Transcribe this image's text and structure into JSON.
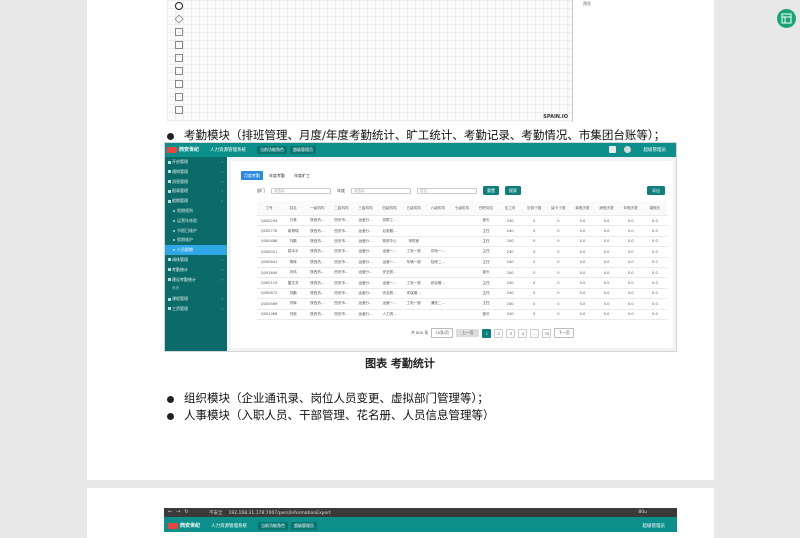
{
  "doc": {
    "fig_top": {
      "brand": "SPAIN.IO",
      "side_hint": "预览",
      "tools": [
        "circle",
        "diamond",
        "rect",
        "rect",
        "rect",
        "rect",
        "rect",
        "rect",
        "rect"
      ]
    },
    "bullets": [
      "考勤模块（排班管理、月度/年度考勤统计、旷工统计、考勤记录、考勤情况、市集团台账等）；",
      "组织模块（企业通讯录、岗位人员变更、虚拟部门管理等）；",
      "人事模块（入职人员、干部管理、花名册、人员信息管理等）"
    ],
    "caption": "图表 考勤统计"
  },
  "app": {
    "logo": "西安世纪",
    "system_name": "人力资源管理系统",
    "crumbs": [
      "当前功能角色",
      "超级管理员"
    ],
    "user": "超级管理员",
    "sidebar": [
      {
        "label": "开启管理",
        "type": "top"
      },
      {
        "label": "通知管理",
        "type": "top"
      },
      {
        "label": "消息管理",
        "type": "top"
      },
      {
        "label": "报表管理",
        "type": "top"
      },
      {
        "label": "假期管理",
        "type": "top"
      },
      {
        "label": "假期规则",
        "type": "sub"
      },
      {
        "label": "运营年休假",
        "type": "sub"
      },
      {
        "label": "节假日维护",
        "type": "sub"
      },
      {
        "label": "假期维护",
        "type": "sub"
      },
      {
        "label": "人员假期",
        "type": "sub",
        "active": true
      },
      {
        "label": "调休管理",
        "type": "top"
      },
      {
        "label": "考勤统计",
        "type": "top"
      },
      {
        "label": "建议考勤统计",
        "type": "top"
      },
      {
        "label": "系统",
        "type": "section"
      },
      {
        "label": "课程管理",
        "type": "top"
      },
      {
        "label": "工资管理",
        "type": "top"
      }
    ],
    "tabs": [
      "月度考勤",
      "年度考勤",
      "年度旷工"
    ],
    "filters": {
      "dept_label": "部门",
      "dept_placeholder": "请选择",
      "year_label": "年度",
      "year_placeholder": "请选择",
      "name_placeholder": "姓名",
      "reset": "重置",
      "search": "搜索",
      "export": "导出"
    },
    "columns": [
      "工号",
      "姓名",
      "一级机构",
      "二级机构",
      "三级机构",
      "四级机构",
      "五级机构",
      "六级机构",
      "七级机构",
      "任职岗位",
      "应工时",
      "迟到个数",
      "缺卡个数",
      "事假天数",
      "病假天数",
      "年假天数",
      "婚假天"
    ],
    "rows": [
      [
        "Q000244",
        "万美",
        "陕西热...",
        "西安市...",
        "运营分...",
        "党群工...",
        "",
        "",
        "",
        "部长",
        "240",
        "0",
        "0",
        "0.0",
        "0.0",
        "0.0",
        "0.0"
      ],
      [
        "Q000776",
        "胡博瑞",
        "陕西热...",
        "西安市...",
        "运营分...",
        "后勤管...",
        "",
        "",
        "",
        "主任",
        "240",
        "0",
        "0",
        "0.0",
        "0.0",
        "0.0",
        "0.0"
      ],
      [
        "Q000486",
        "刘鹏",
        "陕西热...",
        "西安市...",
        "运营分...",
        "物资中心",
        "采购室",
        "",
        "",
        "主任",
        "240",
        "0",
        "0",
        "0.0",
        "0.0",
        "0.0",
        "0.0"
      ],
      [
        "Q000021",
        "葛冰平",
        "陕西热...",
        "西安市...",
        "运营分...",
        "运营一...",
        "工电一部",
        "供电一...",
        "",
        "主任",
        "240",
        "0",
        "0",
        "0.0",
        "0.0",
        "0.0",
        "0.0"
      ],
      [
        "Q000641",
        "周辉",
        "陕西热...",
        "西安市...",
        "运营分...",
        "运营一...",
        "车辆一部",
        "检修二...",
        "",
        "主任",
        "240",
        "0",
        "0",
        "0.0",
        "0.0",
        "0.0",
        "0.0"
      ],
      [
        "Q001649",
        "刘伟",
        "陕西热...",
        "西安市...",
        "运营分...",
        "安全质...",
        "",
        "",
        "",
        "部长",
        "240",
        "0",
        "0",
        "0.0",
        "0.0",
        "0.0",
        "0.0"
      ],
      [
        "Q000119",
        "董文芳",
        "陕西热...",
        "西安市...",
        "运营分...",
        "运营一...",
        "工电一部",
        "综合管...",
        "",
        "主任",
        "240",
        "0",
        "0",
        "0.0",
        "0.0",
        "0.0",
        "0.0"
      ],
      [
        "Q000672",
        "刘鹏",
        "陕西热...",
        "西安市...",
        "运营分...",
        "安全质...",
        "安保管...",
        "",
        "",
        "主任",
        "240",
        "0",
        "0",
        "0.0",
        "0.0",
        "0.0",
        "0.0"
      ],
      [
        "Q000589",
        "刘辉",
        "陕西热...",
        "西安市...",
        "运营分...",
        "运营一...",
        "工电一部",
        "通信二...",
        "",
        "主任",
        "240",
        "0",
        "0",
        "0.0",
        "0.0",
        "0.0",
        "0.0"
      ],
      [
        "Q001086",
        "刘航",
        "陕西热...",
        "西安市...",
        "运营分...",
        "人力资...",
        "",
        "",
        "",
        "部长",
        "240",
        "0",
        "0",
        "0.0",
        "0.0",
        "0.0",
        "0.0"
      ]
    ],
    "pager": {
      "total": "共 800 条",
      "per_page": "10条/页",
      "prev": "上一页",
      "pages": [
        "1",
        "2",
        "3",
        "4",
        "...",
        "70"
      ],
      "next": "下一页"
    }
  },
  "browser": {
    "security": "不安全",
    "url": "192.168.31.178:7007/pers/InformationExport",
    "zoom": "80u",
    "logo": "西安世纪",
    "system_name": "人力资源管理系统",
    "crumbs": [
      "当前功能角色",
      "超级管理员"
    ],
    "user": "超级管理员"
  }
}
